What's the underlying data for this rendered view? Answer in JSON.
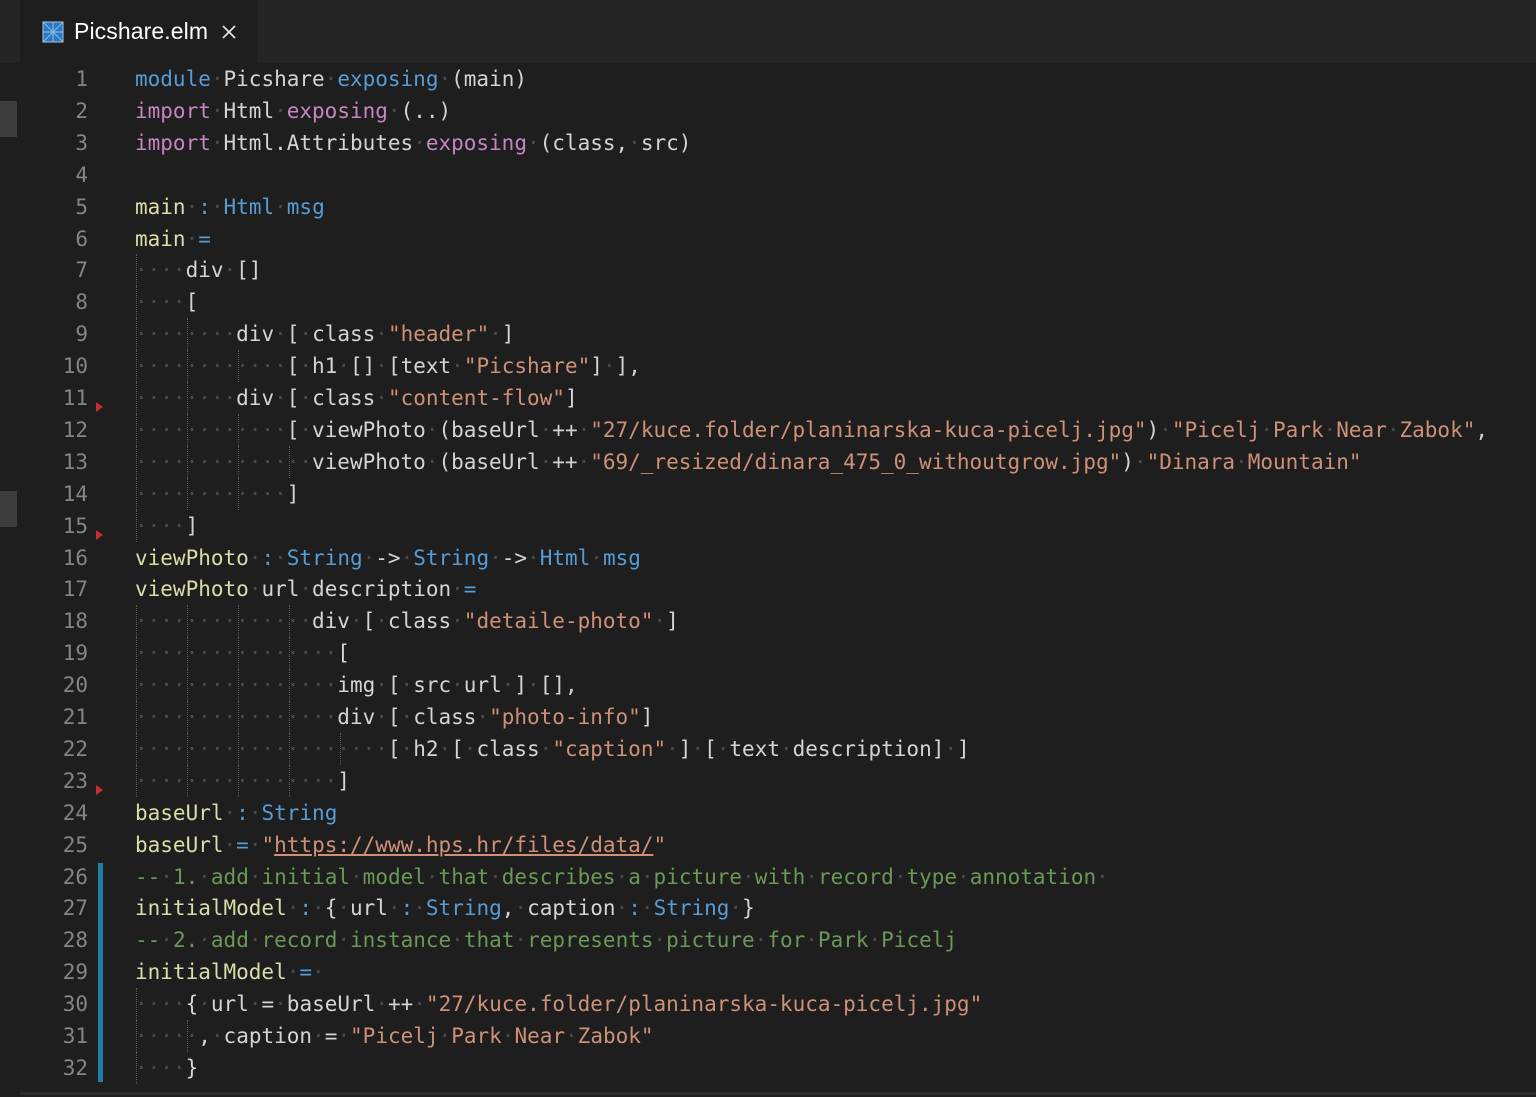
{
  "tab": {
    "title": "Picshare.elm",
    "icon": "elm-icon",
    "close_icon": "close-icon"
  },
  "colors": {
    "keyword": "#c586c0",
    "type": "#569cd6",
    "function": "#dcdcaa",
    "string": "#ce9178",
    "comment": "#6a9955",
    "text": "#d4d4d4",
    "diff_bar": "#1b81a8"
  },
  "gutter": {
    "line_numbers": [
      "1",
      "2",
      "3",
      "4",
      "5",
      "6",
      "7",
      "8",
      "9",
      "10",
      "11",
      "12",
      "13",
      "14",
      "15",
      "16",
      "17",
      "18",
      "19",
      "20",
      "21",
      "22",
      "23",
      "24",
      "25",
      "26",
      "27",
      "28",
      "29",
      "30",
      "31",
      "32"
    ]
  },
  "code": {
    "lines": [
      [
        [
          "ty",
          "module"
        ],
        [
          "ws",
          "·"
        ],
        [
          "pl",
          "Picshare"
        ],
        [
          "ws",
          "·"
        ],
        [
          "ty",
          "exposing"
        ],
        [
          "ws",
          "·"
        ],
        [
          "pl",
          "(main)"
        ]
      ],
      [
        [
          "kw",
          "import"
        ],
        [
          "ws",
          "·"
        ],
        [
          "pl",
          "Html"
        ],
        [
          "ws",
          "·"
        ],
        [
          "kw",
          "exposing"
        ],
        [
          "ws",
          "·"
        ],
        [
          "pl",
          "(..)"
        ]
      ],
      [
        [
          "kw",
          "import"
        ],
        [
          "ws",
          "·"
        ],
        [
          "pl",
          "Html.Attributes"
        ],
        [
          "ws",
          "·"
        ],
        [
          "kw",
          "exposing"
        ],
        [
          "ws",
          "·"
        ],
        [
          "pl",
          "(class,"
        ],
        [
          "ws",
          "·"
        ],
        [
          "pl",
          "src)"
        ]
      ],
      [],
      [
        [
          "fn",
          "main"
        ],
        [
          "ws",
          "·"
        ],
        [
          "ty",
          ":"
        ],
        [
          "ws",
          "·"
        ],
        [
          "ty",
          "Html"
        ],
        [
          "ws",
          "·"
        ],
        [
          "ty",
          "msg"
        ]
      ],
      [
        [
          "fn",
          "main"
        ],
        [
          "ws",
          "·"
        ],
        [
          "ty",
          "="
        ]
      ],
      [
        [
          "ws",
          "····"
        ],
        [
          "pl",
          "div"
        ],
        [
          "ws",
          "·"
        ],
        [
          "pl",
          "[]"
        ]
      ],
      [
        [
          "ws",
          "····"
        ],
        [
          "pl",
          "["
        ]
      ],
      [
        [
          "ws",
          "········"
        ],
        [
          "pl",
          "div"
        ],
        [
          "ws",
          "·"
        ],
        [
          "pl",
          "["
        ],
        [
          "ws",
          "·"
        ],
        [
          "pl",
          "class"
        ],
        [
          "ws",
          "·"
        ],
        [
          "str",
          "\"header\""
        ],
        [
          "ws",
          "·"
        ],
        [
          "pl",
          "]"
        ]
      ],
      [
        [
          "ws",
          "············"
        ],
        [
          "pl",
          "["
        ],
        [
          "ws",
          "·"
        ],
        [
          "pl",
          "h1"
        ],
        [
          "ws",
          "·"
        ],
        [
          "pl",
          "[]"
        ],
        [
          "ws",
          "·"
        ],
        [
          "pl",
          "[text"
        ],
        [
          "ws",
          "·"
        ],
        [
          "str",
          "\"Picshare\""
        ],
        [
          "pl",
          "]"
        ],
        [
          "ws",
          "·"
        ],
        [
          "pl",
          "],"
        ]
      ],
      [
        [
          "ws",
          "········"
        ],
        [
          "pl",
          "div"
        ],
        [
          "ws",
          "·"
        ],
        [
          "pl",
          "["
        ],
        [
          "ws",
          "·"
        ],
        [
          "pl",
          "class"
        ],
        [
          "ws",
          "·"
        ],
        [
          "str",
          "\"content-flow\""
        ],
        [
          "pl",
          "]"
        ]
      ],
      [
        [
          "ws",
          "············"
        ],
        [
          "pl",
          "["
        ],
        [
          "ws",
          "·"
        ],
        [
          "pl",
          "viewPhoto"
        ],
        [
          "ws",
          "·"
        ],
        [
          "pl",
          "(baseUrl"
        ],
        [
          "ws",
          "·"
        ],
        [
          "pl",
          "++"
        ],
        [
          "ws",
          "·"
        ],
        [
          "str",
          "\"27/kuce.folder/planinarska-kuca-picelj.jpg\""
        ],
        [
          "pl",
          ")"
        ],
        [
          "ws",
          "·"
        ],
        [
          "str",
          "\"Picelj"
        ],
        [
          "ws",
          "·"
        ],
        [
          "str",
          "Park"
        ],
        [
          "ws",
          "·"
        ],
        [
          "str",
          "Near"
        ],
        [
          "ws",
          "·"
        ],
        [
          "str",
          "Zabok\""
        ],
        [
          "pl",
          ","
        ]
      ],
      [
        [
          "ws",
          "··············"
        ],
        [
          "pl",
          "viewPhoto"
        ],
        [
          "ws",
          "·"
        ],
        [
          "pl",
          "(baseUrl"
        ],
        [
          "ws",
          "·"
        ],
        [
          "pl",
          "++"
        ],
        [
          "ws",
          "·"
        ],
        [
          "str",
          "\"69/_resized/dinara_475_0_withoutgrow.jpg\""
        ],
        [
          "pl",
          ")"
        ],
        [
          "ws",
          "·"
        ],
        [
          "str",
          "\"Dinara"
        ],
        [
          "ws",
          "·"
        ],
        [
          "str",
          "Mountain\""
        ]
      ],
      [
        [
          "ws",
          "············"
        ],
        [
          "pl",
          "]"
        ]
      ],
      [
        [
          "ws",
          "····"
        ],
        [
          "pl",
          "]"
        ]
      ],
      [
        [
          "fn",
          "viewPhoto"
        ],
        [
          "ws",
          "·"
        ],
        [
          "ty",
          ":"
        ],
        [
          "ws",
          "·"
        ],
        [
          "ty",
          "String"
        ],
        [
          "ws",
          "·"
        ],
        [
          "pl",
          "->"
        ],
        [
          "ws",
          "·"
        ],
        [
          "ty",
          "String"
        ],
        [
          "ws",
          "·"
        ],
        [
          "pl",
          "->"
        ],
        [
          "ws",
          "·"
        ],
        [
          "ty",
          "Html"
        ],
        [
          "ws",
          "·"
        ],
        [
          "ty",
          "msg"
        ]
      ],
      [
        [
          "fn",
          "viewPhoto"
        ],
        [
          "ws",
          "·"
        ],
        [
          "pl",
          "url"
        ],
        [
          "ws",
          "·"
        ],
        [
          "pl",
          "description"
        ],
        [
          "ws",
          "·"
        ],
        [
          "ty",
          "="
        ]
      ],
      [
        [
          "ws",
          "··············"
        ],
        [
          "pl",
          "div"
        ],
        [
          "ws",
          "·"
        ],
        [
          "pl",
          "["
        ],
        [
          "ws",
          "·"
        ],
        [
          "pl",
          "class"
        ],
        [
          "ws",
          "·"
        ],
        [
          "str",
          "\"detaile-photo\""
        ],
        [
          "ws",
          "·"
        ],
        [
          "pl",
          "]"
        ]
      ],
      [
        [
          "ws",
          "················"
        ],
        [
          "pl",
          "["
        ]
      ],
      [
        [
          "ws",
          "················"
        ],
        [
          "pl",
          "img"
        ],
        [
          "ws",
          "·"
        ],
        [
          "pl",
          "["
        ],
        [
          "ws",
          "·"
        ],
        [
          "pl",
          "src"
        ],
        [
          "ws",
          "·"
        ],
        [
          "pl",
          "url"
        ],
        [
          "ws",
          "·"
        ],
        [
          "pl",
          "]"
        ],
        [
          "ws",
          "·"
        ],
        [
          "pl",
          "[],"
        ]
      ],
      [
        [
          "ws",
          "················"
        ],
        [
          "pl",
          "div"
        ],
        [
          "ws",
          "·"
        ],
        [
          "pl",
          "["
        ],
        [
          "ws",
          "·"
        ],
        [
          "pl",
          "class"
        ],
        [
          "ws",
          "·"
        ],
        [
          "str",
          "\"photo-info\""
        ],
        [
          "pl",
          "]"
        ]
      ],
      [
        [
          "ws",
          "····················"
        ],
        [
          "pl",
          "["
        ],
        [
          "ws",
          "·"
        ],
        [
          "pl",
          "h2"
        ],
        [
          "ws",
          "·"
        ],
        [
          "pl",
          "["
        ],
        [
          "ws",
          "·"
        ],
        [
          "pl",
          "class"
        ],
        [
          "ws",
          "·"
        ],
        [
          "str",
          "\"caption\""
        ],
        [
          "ws",
          "·"
        ],
        [
          "pl",
          "]"
        ],
        [
          "ws",
          "·"
        ],
        [
          "pl",
          "["
        ],
        [
          "ws",
          "·"
        ],
        [
          "pl",
          "text"
        ],
        [
          "ws",
          "·"
        ],
        [
          "pl",
          "description]"
        ],
        [
          "ws",
          "·"
        ],
        [
          "pl",
          "]"
        ]
      ],
      [
        [
          "ws",
          "················"
        ],
        [
          "pl",
          "]"
        ]
      ],
      [
        [
          "fn",
          "baseUrl"
        ],
        [
          "ws",
          "·"
        ],
        [
          "ty",
          ":"
        ],
        [
          "ws",
          "·"
        ],
        [
          "ty",
          "String"
        ]
      ],
      [
        [
          "fn",
          "baseUrl"
        ],
        [
          "ws",
          "·"
        ],
        [
          "ty",
          "="
        ],
        [
          "ws",
          "·"
        ],
        [
          "str",
          "\""
        ],
        [
          "url",
          "https://www.hps.hr/files/data/"
        ],
        [
          "str",
          "\""
        ]
      ],
      [
        [
          "cm",
          "--"
        ],
        [
          "ws",
          "·"
        ],
        [
          "cm",
          "1."
        ],
        [
          "ws",
          "·"
        ],
        [
          "cm",
          "add"
        ],
        [
          "ws",
          "·"
        ],
        [
          "cm",
          "initial"
        ],
        [
          "ws",
          "·"
        ],
        [
          "cm",
          "model"
        ],
        [
          "ws",
          "·"
        ],
        [
          "cm",
          "that"
        ],
        [
          "ws",
          "·"
        ],
        [
          "cm",
          "describes"
        ],
        [
          "ws",
          "·"
        ],
        [
          "cm",
          "a"
        ],
        [
          "ws",
          "·"
        ],
        [
          "cm",
          "picture"
        ],
        [
          "ws",
          "·"
        ],
        [
          "cm",
          "with"
        ],
        [
          "ws",
          "·"
        ],
        [
          "cm",
          "record"
        ],
        [
          "ws",
          "·"
        ],
        [
          "cm",
          "type"
        ],
        [
          "ws",
          "·"
        ],
        [
          "cm",
          "annotation"
        ],
        [
          "ws",
          "·"
        ]
      ],
      [
        [
          "fn",
          "initialModel"
        ],
        [
          "ws",
          "·"
        ],
        [
          "ty",
          ":"
        ],
        [
          "ws",
          "·"
        ],
        [
          "pl",
          "{"
        ],
        [
          "ws",
          "·"
        ],
        [
          "pl",
          "url"
        ],
        [
          "ws",
          "·"
        ],
        [
          "ty",
          ":"
        ],
        [
          "ws",
          "·"
        ],
        [
          "ty",
          "String"
        ],
        [
          "pl",
          ","
        ],
        [
          "ws",
          "·"
        ],
        [
          "pl",
          "caption"
        ],
        [
          "ws",
          "·"
        ],
        [
          "ty",
          ":"
        ],
        [
          "ws",
          "·"
        ],
        [
          "ty",
          "String"
        ],
        [
          "ws",
          "·"
        ],
        [
          "pl",
          "}"
        ]
      ],
      [
        [
          "cm",
          "--"
        ],
        [
          "ws",
          "·"
        ],
        [
          "cm",
          "2."
        ],
        [
          "ws",
          "·"
        ],
        [
          "cm",
          "add"
        ],
        [
          "ws",
          "·"
        ],
        [
          "cm",
          "record"
        ],
        [
          "ws",
          "·"
        ],
        [
          "cm",
          "instance"
        ],
        [
          "ws",
          "·"
        ],
        [
          "cm",
          "that"
        ],
        [
          "ws",
          "·"
        ],
        [
          "cm",
          "represents"
        ],
        [
          "ws",
          "·"
        ],
        [
          "cm",
          "picture"
        ],
        [
          "ws",
          "·"
        ],
        [
          "cm",
          "for"
        ],
        [
          "ws",
          "·"
        ],
        [
          "cm",
          "Park"
        ],
        [
          "ws",
          "·"
        ],
        [
          "cm",
          "Picelj"
        ]
      ],
      [
        [
          "fn",
          "initialModel"
        ],
        [
          "ws",
          "·"
        ],
        [
          "ty",
          "="
        ],
        [
          "ws",
          "·"
        ]
      ],
      [
        [
          "ws",
          "····"
        ],
        [
          "pl",
          "{"
        ],
        [
          "ws",
          "·"
        ],
        [
          "pl",
          "url"
        ],
        [
          "ws",
          "·"
        ],
        [
          "pl",
          "="
        ],
        [
          "ws",
          "·"
        ],
        [
          "pl",
          "baseUrl"
        ],
        [
          "ws",
          "·"
        ],
        [
          "pl",
          "++"
        ],
        [
          "ws",
          "·"
        ],
        [
          "str",
          "\"27/kuce.folder/planinarska-kuca-picelj.jpg\""
        ]
      ],
      [
        [
          "ws",
          "····"
        ],
        [
          "ws",
          "·"
        ],
        [
          "pl",
          ","
        ],
        [
          "ws",
          "·"
        ],
        [
          "pl",
          "caption"
        ],
        [
          "ws",
          "·"
        ],
        [
          "pl",
          "="
        ],
        [
          "ws",
          "·"
        ],
        [
          "str",
          "\"Picelj"
        ],
        [
          "ws",
          "·"
        ],
        [
          "str",
          "Park"
        ],
        [
          "ws",
          "·"
        ],
        [
          "str",
          "Near"
        ],
        [
          "ws",
          "·"
        ],
        [
          "str",
          "Zabok\""
        ]
      ],
      [
        [
          "ws",
          "····"
        ],
        [
          "pl",
          "}"
        ]
      ]
    ]
  }
}
